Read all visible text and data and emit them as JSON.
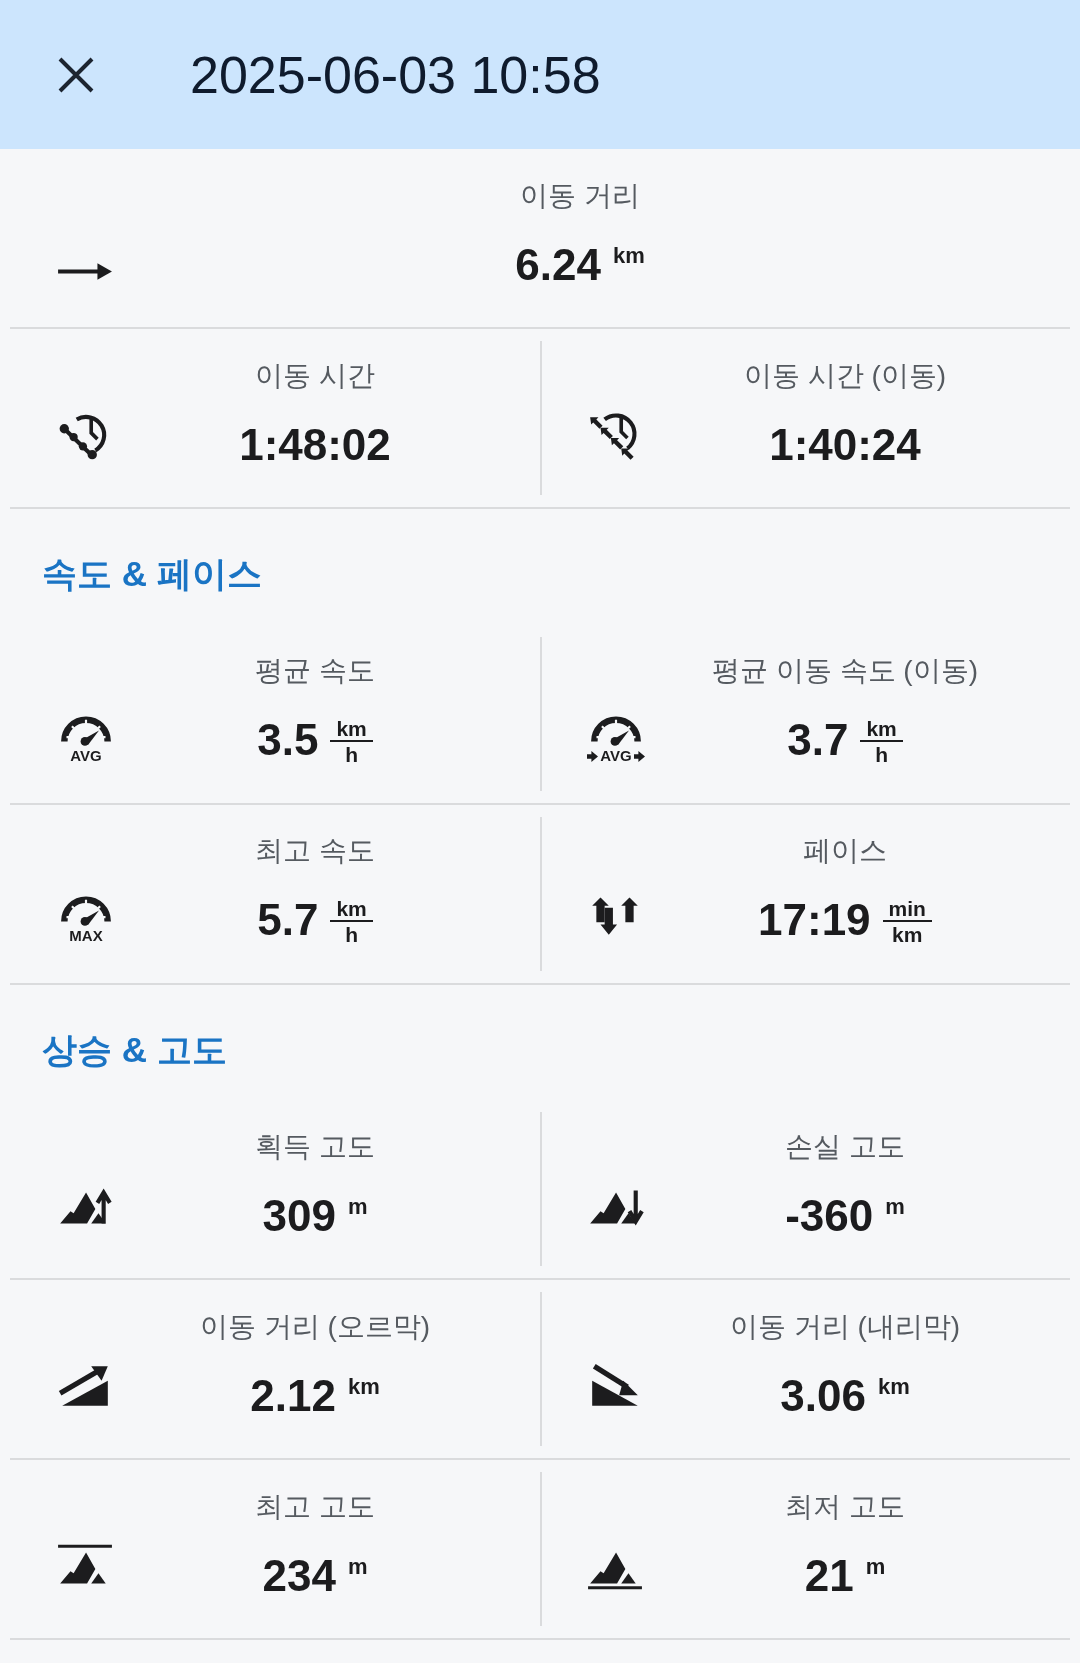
{
  "header": {
    "title": "2025-06-03 10:58"
  },
  "sections": [
    {
      "rows": [
        {
          "cells": [
            {
              "kind": "arrow",
              "label": "이동 거리",
              "value": "6.24",
              "unit": {
                "kind": "inline",
                "text": "km"
              }
            }
          ]
        },
        {
          "cells": [
            {
              "kind": "clock-dots",
              "label": "이동 시간",
              "value": "1:48:02"
            },
            {
              "kind": "clock-arrows",
              "label": "이동 시간 (이동)",
              "value": "1:40:24"
            }
          ]
        }
      ]
    },
    {
      "heading": "속도 & 페이스",
      "rows": [
        {
          "cells": [
            {
              "kind": "gauge",
              "icon_text": "AVG",
              "label": "평균 속도",
              "value": "3.5",
              "unit": {
                "kind": "fraction",
                "top": "km",
                "bottom": "h"
              }
            },
            {
              "kind": "gauge-arrows",
              "icon_text": "AVG",
              "label": "평균 이동 속도 (이동)",
              "value": "3.7",
              "unit": {
                "kind": "fraction",
                "top": "km",
                "bottom": "h"
              }
            }
          ]
        },
        {
          "cells": [
            {
              "kind": "gauge",
              "icon_text": "MAX",
              "label": "최고 속도",
              "value": "5.7",
              "unit": {
                "kind": "fraction",
                "top": "km",
                "bottom": "h"
              }
            },
            {
              "kind": "pace",
              "label": "페이스",
              "value": "17:19",
              "unit": {
                "kind": "fraction",
                "top": "min",
                "bottom": "km"
              }
            }
          ]
        }
      ]
    },
    {
      "heading": "상승 & 고도",
      "rows": [
        {
          "cells": [
            {
              "kind": "ascent",
              "label": "획득 고도",
              "value": "309",
              "unit": {
                "kind": "inline",
                "text": "m"
              }
            },
            {
              "kind": "descent",
              "label": "손실 고도",
              "value": "-360",
              "unit": {
                "kind": "inline",
                "text": "m"
              }
            }
          ]
        },
        {
          "cells": [
            {
              "kind": "slope-up",
              "label": "이동 거리 (오르막)",
              "value": "2.12",
              "unit": {
                "kind": "inline",
                "text": "km"
              }
            },
            {
              "kind": "slope-down",
              "label": "이동 거리 (내리막)",
              "value": "3.06",
              "unit": {
                "kind": "inline",
                "text": "km"
              }
            }
          ]
        },
        {
          "cells": [
            {
              "kind": "peak",
              "label": "최고 고도",
              "value": "234",
              "unit": {
                "kind": "inline",
                "text": "m"
              }
            },
            {
              "kind": "low",
              "label": "최저 고도",
              "value": "21",
              "unit": {
                "kind": "inline",
                "text": "m"
              }
            }
          ]
        }
      ]
    }
  ]
}
